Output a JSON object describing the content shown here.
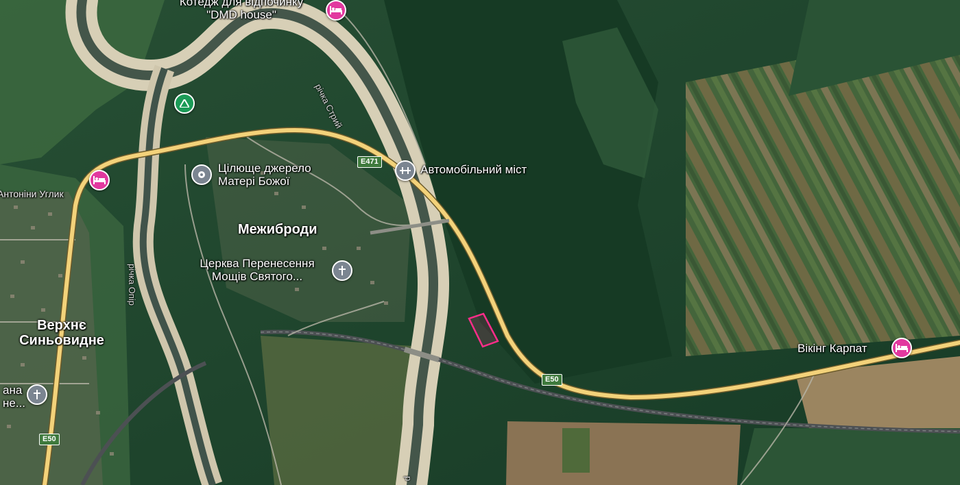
{
  "map": {
    "colors": {
      "forest": "#1e4a30",
      "forest_dark": "#163b25",
      "meadow": "#5d7f48",
      "field": "#8a7a58",
      "river_bank": "#d9cfb8",
      "river_water": "#4a5a4a",
      "road_main": "#f3d27a",
      "railway": "#555a5c",
      "lodging_pin": "#e2389f",
      "poi_pin": "#7b8591",
      "camp_pin": "#1b9b57",
      "parcel_outline": "#ff2d8a"
    },
    "places": {
      "village_mezhybrody": "Межиброди",
      "village_verkhnie_l1": "Верхнє",
      "village_verkhnie_l2": "Синьовидне"
    },
    "pois": {
      "dmd_house_l1": "Котедж для відпочинку",
      "dmd_house_l2": "\"DMD house\"",
      "spring_l1": "Цілюще джерело",
      "spring_l2": "Матері Божої",
      "bridge": "Автомобільний міст",
      "church_l1": "Церква Перенесення",
      "church_l2": "Мощів Святого...",
      "viking": "Вікінг Карпат",
      "left_church_l1": "ана",
      "left_church_l2": "не...",
      "street": "Антоніни Углик"
    },
    "roads": {
      "e471": "E471",
      "e50_main": "E50",
      "e50_left": "E50"
    },
    "rivers": {
      "stryi": "річка Стрий",
      "opir": "річка Опір",
      "bottom_r": "р"
    },
    "icons": {
      "lodging": "bed-icon",
      "spring": "pin-icon",
      "bridge": "bridge-icon",
      "church": "cross-icon",
      "camp": "campsite-icon"
    }
  }
}
